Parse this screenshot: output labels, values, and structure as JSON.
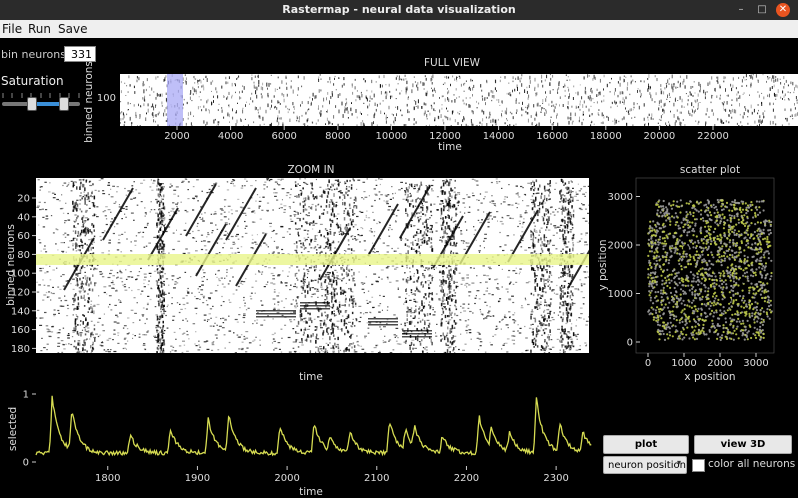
{
  "window": {
    "title": "Rastermap - neural data visualization",
    "controls": {
      "minimize": "–",
      "maximize": "□",
      "close": "✕"
    }
  },
  "menu": [
    "File",
    "Run",
    "Save"
  ],
  "controls": {
    "bin_label": "bin neurons:",
    "bin_value": "331",
    "saturation_label": "Saturation",
    "saturation_range": [
      0.37,
      0.78
    ]
  },
  "full_view": {
    "title": "FULL VIEW",
    "ylabel": "binned neurons",
    "xlabel": "time",
    "ytick": "100",
    "xticks": [
      "2000",
      "4000",
      "6000",
      "8000",
      "10000",
      "12000",
      "14000",
      "16000",
      "18000",
      "20000",
      "22000"
    ],
    "highlight_color": "#a9a9f5"
  },
  "zoom": {
    "title": "ZOOM IN",
    "ylabel": "binned neurons",
    "xlabel": "time",
    "yticks": [
      "20",
      "40",
      "60",
      "80",
      "100",
      "120",
      "140",
      "160",
      "180"
    ],
    "selection_color": "#e8f58a"
  },
  "scatter": {
    "title": "scatter plot",
    "xlabel": "x position",
    "ylabel": "y position",
    "xticks": [
      "0",
      "1000",
      "2000",
      "3000"
    ],
    "yticks": [
      "0",
      "1000",
      "2000",
      "3000"
    ],
    "point_color": "#9a9a9a",
    "selected_color": "#bcc94a"
  },
  "trace": {
    "ylabel": "selected",
    "xlabel": "time",
    "yticks": [
      "0",
      "1"
    ],
    "xticks": [
      "1800",
      "1900",
      "2000",
      "2100",
      "2200",
      "2300"
    ],
    "line_color": "#d6dc52",
    "peak_times": [
      1738,
      1760,
      1825,
      1870,
      1912,
      1935,
      1992,
      2030,
      2048,
      2070,
      2114,
      2132,
      2142,
      2173,
      2214,
      2228,
      2248,
      2278,
      2304,
      2330
    ]
  },
  "buttons": {
    "plot": "plot",
    "view3d": "view 3D"
  },
  "combo": {
    "value": "neuron position"
  },
  "checkbox": {
    "label": "color all neurons",
    "checked": false
  }
}
